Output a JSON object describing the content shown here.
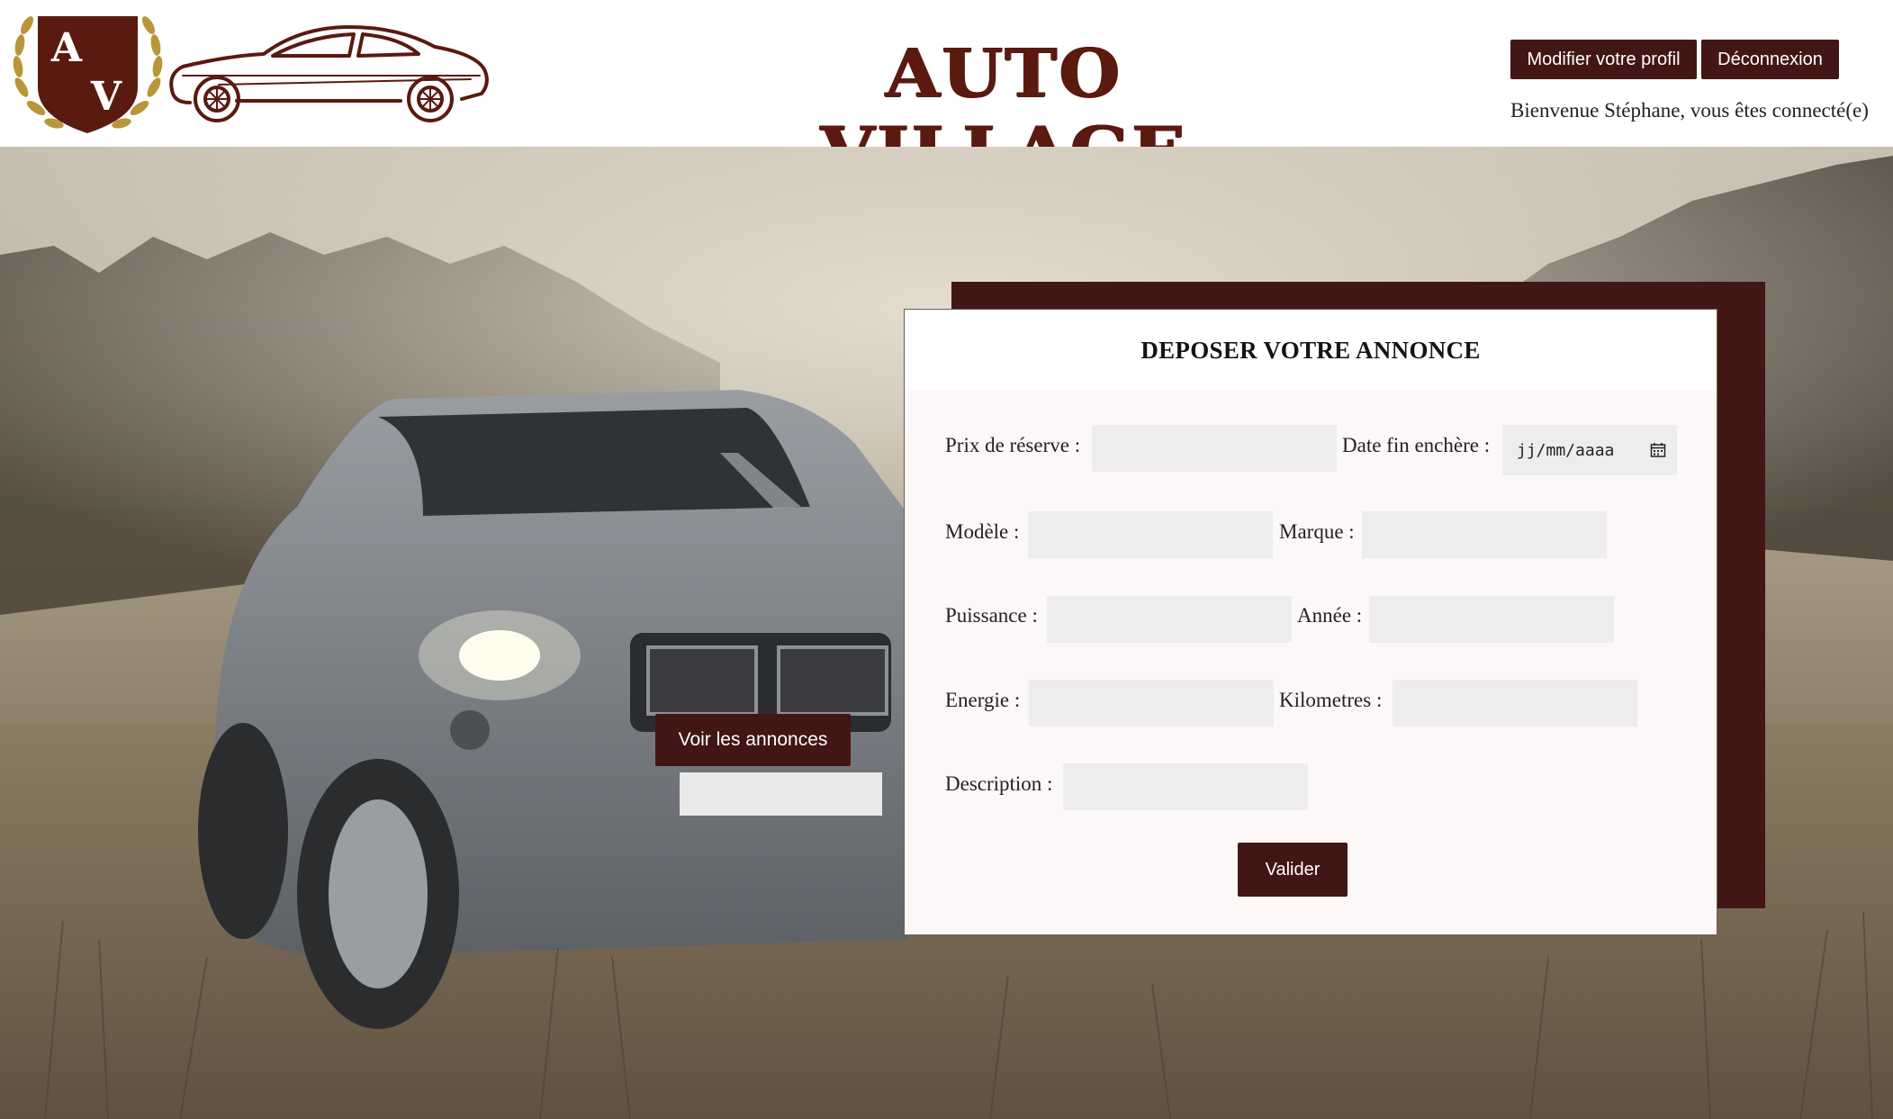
{
  "header": {
    "logo_letters": [
      "A",
      "V"
    ],
    "site_title": "AUTO VILLAGE",
    "profile_button": "Modifier votre profil",
    "logout_button": "Déconnexion",
    "welcome_text": "Bienvenue Stéphane, vous êtes connecté(e)"
  },
  "hero": {
    "view_ads_button": "Voir les annonces"
  },
  "form": {
    "title": "DEPOSER VOTRE ANNONCE",
    "labels": {
      "reserve_price": "Prix de réserve :",
      "end_date": "Date fin enchère :",
      "model": "Modèle :",
      "brand": "Marque :",
      "power": "Puissance :",
      "year": "Année :",
      "energy": "Energie :",
      "mileage": "Kilometres :",
      "description": "Description :"
    },
    "values": {
      "reserve_price": "",
      "model": "",
      "brand": "",
      "power": "",
      "year": "",
      "energy": "",
      "mileage": "",
      "description": ""
    },
    "date_placeholder": "jj/mm/aaaa",
    "submit_button": "Valider"
  },
  "colors": {
    "brand_dark": "#431616",
    "title_brown": "#5a1a10",
    "logo_gold": "#b8963a"
  },
  "icons": {
    "date_picker": "calendar-icon"
  }
}
